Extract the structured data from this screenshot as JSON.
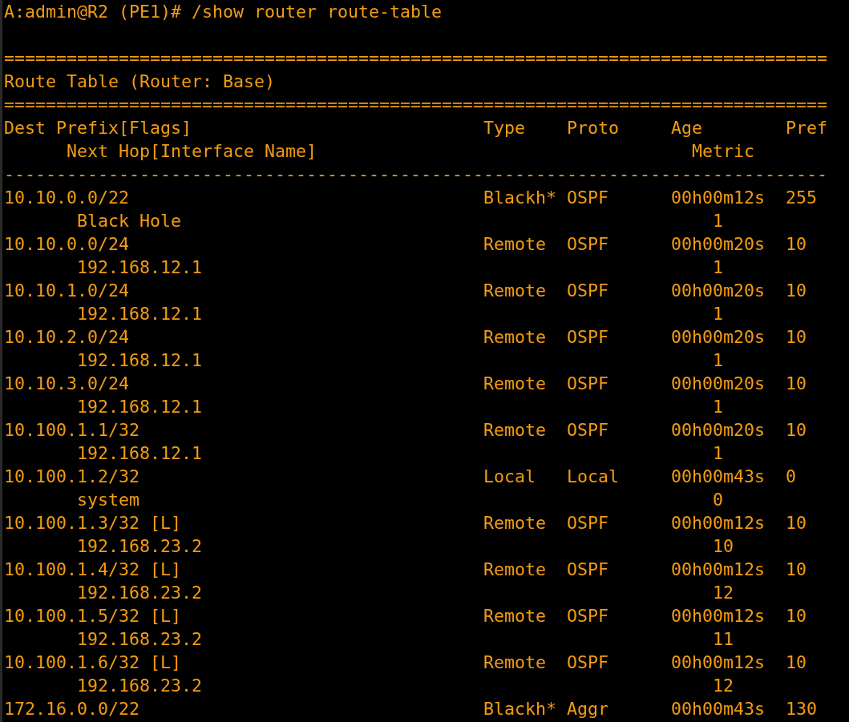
{
  "terminal": {
    "command_line": "A:admin@R2 (PE1)# /show router route-table",
    "rule_top": "===============================================================================",
    "title": "Route Table (Router: Base)",
    "rule_mid": "===============================================================================",
    "columns": {
      "dest_prefix": "Dest Prefix[Flags]",
      "type": "Type",
      "proto": "Proto",
      "age": "Age",
      "pref": "Pref",
      "next_hop": "Next Hop[Interface Name]",
      "metric": "Metric"
    },
    "rule_dash": "-------------------------------------------------------------------------------",
    "routes": [
      {
        "prefix": "10.10.0.0/22",
        "type": "Blackh*",
        "proto": "OSPF",
        "age": "00h00m12s",
        "pref": "255",
        "next_hop": "Black Hole",
        "metric": "1"
      },
      {
        "prefix": "10.10.0.0/24",
        "type": "Remote",
        "proto": "OSPF",
        "age": "00h00m20s",
        "pref": "10",
        "next_hop": "192.168.12.1",
        "metric": "1"
      },
      {
        "prefix": "10.10.1.0/24",
        "type": "Remote",
        "proto": "OSPF",
        "age": "00h00m20s",
        "pref": "10",
        "next_hop": "192.168.12.1",
        "metric": "1"
      },
      {
        "prefix": "10.10.2.0/24",
        "type": "Remote",
        "proto": "OSPF",
        "age": "00h00m20s",
        "pref": "10",
        "next_hop": "192.168.12.1",
        "metric": "1"
      },
      {
        "prefix": "10.10.3.0/24",
        "type": "Remote",
        "proto": "OSPF",
        "age": "00h00m20s",
        "pref": "10",
        "next_hop": "192.168.12.1",
        "metric": "1"
      },
      {
        "prefix": "10.100.1.1/32",
        "type": "Remote",
        "proto": "OSPF",
        "age": "00h00m20s",
        "pref": "10",
        "next_hop": "192.168.12.1",
        "metric": "1"
      },
      {
        "prefix": "10.100.1.2/32",
        "type": "Local",
        "proto": "Local",
        "age": "00h00m43s",
        "pref": "0",
        "next_hop": "system",
        "metric": "0"
      },
      {
        "prefix": "10.100.1.3/32 [L]",
        "type": "Remote",
        "proto": "OSPF",
        "age": "00h00m12s",
        "pref": "10",
        "next_hop": "192.168.23.2",
        "metric": "10"
      },
      {
        "prefix": "10.100.1.4/32 [L]",
        "type": "Remote",
        "proto": "OSPF",
        "age": "00h00m12s",
        "pref": "10",
        "next_hop": "192.168.23.2",
        "metric": "12"
      },
      {
        "prefix": "10.100.1.5/32 [L]",
        "type": "Remote",
        "proto": "OSPF",
        "age": "00h00m12s",
        "pref": "10",
        "next_hop": "192.168.23.2",
        "metric": "11"
      },
      {
        "prefix": "10.100.1.6/32 [L]",
        "type": "Remote",
        "proto": "OSPF",
        "age": "00h00m12s",
        "pref": "10",
        "next_hop": "192.168.23.2",
        "metric": "12"
      },
      {
        "prefix": "172.16.0.0/22",
        "type": "Blackh*",
        "proto": "Aggr",
        "age": "00h00m43s",
        "pref": "130"
      }
    ]
  }
}
